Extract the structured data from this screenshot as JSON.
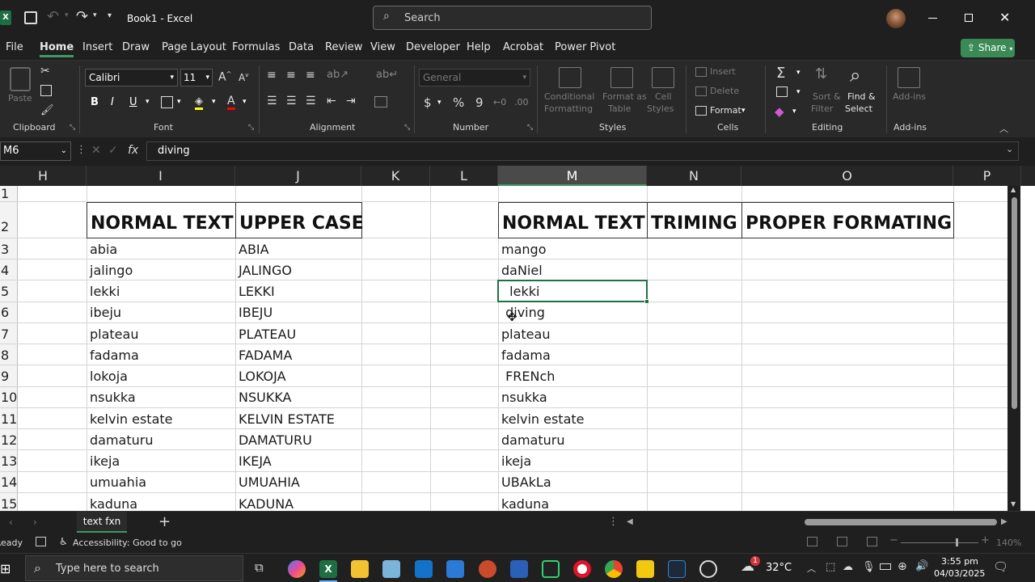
{
  "titlebar": {
    "title": "Book1  -  Excel",
    "search_placeholder": "Search",
    "app_letter": "X"
  },
  "menu": {
    "items": [
      "File",
      "Home",
      "Insert",
      "Draw",
      "Page Layout",
      "Formulas",
      "Data",
      "Review",
      "View",
      "Developer",
      "Help",
      "Acrobat",
      "Power Pivot"
    ],
    "share": "Share"
  },
  "ribbon": {
    "font_name": "Calibri",
    "font_size": "11",
    "number_format": "General",
    "groups": {
      "clipboard": "Clipboard",
      "font": "Font",
      "alignment": "Alignment",
      "number": "Number",
      "styles": "Styles",
      "cells": "Cells",
      "editing": "Editing",
      "addins": "Add-ins"
    },
    "paste": "Paste",
    "conditional": "Conditional",
    "formatting": "Formatting",
    "format_as": "Format as",
    "table": "Table",
    "cell": "Cell",
    "styles_lbl": "Styles",
    "insert": "Insert",
    "delete": "Delete",
    "format": "Format",
    "sort": "Sort &",
    "filter": "Filter",
    "find": "Find &",
    "select": "Select",
    "addins": "Add-ins",
    "bold": "B",
    "italic": "I",
    "underline": "U"
  },
  "formula_bar": {
    "name_box": "M6",
    "fx": "fx",
    "value": "diving"
  },
  "columns": [
    "H",
    "I",
    "J",
    "K",
    "L",
    "M",
    "N",
    "O",
    "P"
  ],
  "rows": [
    "1",
    "2",
    "3",
    "4",
    "5",
    "6",
    "7",
    "8",
    "9",
    "10",
    "11",
    "12",
    "13",
    "14",
    "15"
  ],
  "headers": {
    "i": "NORMAL TEXT",
    "j": "UPPER CASE",
    "m": "NORMAL TEXT",
    "n": "TRIMING",
    "o": "PROPER FORMATING"
  },
  "col_i": [
    "abia",
    "jalingo",
    "lekki",
    "ibeju",
    "plateau",
    "fadama",
    "lokoja",
    "nsukka",
    "kelvin estate",
    "damaturu",
    "ikeja",
    "umuahia",
    "kaduna"
  ],
  "col_j": [
    "ABIA",
    "JALINGO",
    "LEKKI",
    "IBEJU",
    "PLATEAU",
    "FADAMA",
    "LOKOJA",
    "NSUKKA",
    "KELVIN ESTATE",
    "DAMATURU",
    "IKEJA",
    "UMUAHIA",
    "KADUNA"
  ],
  "col_m": [
    "mango",
    "daNiel",
    "  lekki",
    " diving",
    "plateau",
    "fadama",
    " FRENch",
    "nsukka",
    "kelvin estate",
    "damaturu",
    "ikeja",
    "UBAkLa",
    "kaduna"
  ],
  "sheet_tab": "text fxn",
  "status": {
    "ready": "Ready",
    "accessibility": "Accessibility: Good to go",
    "zoom": "140%"
  },
  "taskbar": {
    "search": "Type here to search",
    "temp": "32°C",
    "time": "3:55 pm",
    "date": "04/03/2025",
    "notif": "1"
  }
}
